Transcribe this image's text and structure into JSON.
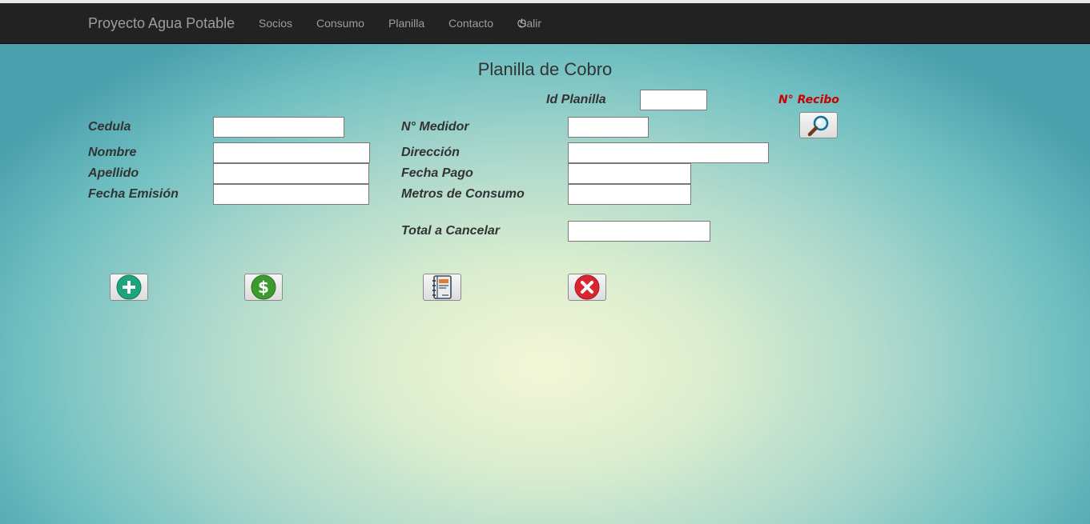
{
  "navbar": {
    "brand": "Proyecto Agua Potable",
    "items": [
      {
        "label": "Socios"
      },
      {
        "label": "Consumo"
      },
      {
        "label": "Planilla"
      },
      {
        "label": "Contacto"
      },
      {
        "label": "Salir",
        "icon": "power-icon"
      }
    ]
  },
  "page": {
    "title": "Planilla de Cobro"
  },
  "form": {
    "id_planilla": {
      "label": "Id Planilla",
      "value": ""
    },
    "recibo": {
      "label": "N° Recibo"
    },
    "cedula": {
      "label": "Cedula",
      "value": ""
    },
    "nombre": {
      "label": "Nombre",
      "value": ""
    },
    "apellido": {
      "label": "Apellido",
      "value": ""
    },
    "fecha_emision": {
      "label": "Fecha Emisión",
      "value": ""
    },
    "medidor": {
      "label": "N° Medidor",
      "value": ""
    },
    "direccion": {
      "label": "Dirección",
      "value": ""
    },
    "fecha_pago": {
      "label": "Fecha Pago",
      "value": ""
    },
    "metros": {
      "label": "Metros de Consumo",
      "value": ""
    },
    "total": {
      "label": "Total a Cancelar",
      "value": ""
    }
  },
  "actions": [
    {
      "name": "add",
      "icon": "plus-icon",
      "color": "#1fa37f"
    },
    {
      "name": "pay",
      "icon": "dollar-icon",
      "color": "#3c9a2e"
    },
    {
      "name": "report",
      "icon": "notebook-icon",
      "color": "#e07a3a"
    },
    {
      "name": "cancel",
      "icon": "close-icon",
      "color": "#d9262e"
    }
  ],
  "search": {
    "icon": "search-icon"
  }
}
